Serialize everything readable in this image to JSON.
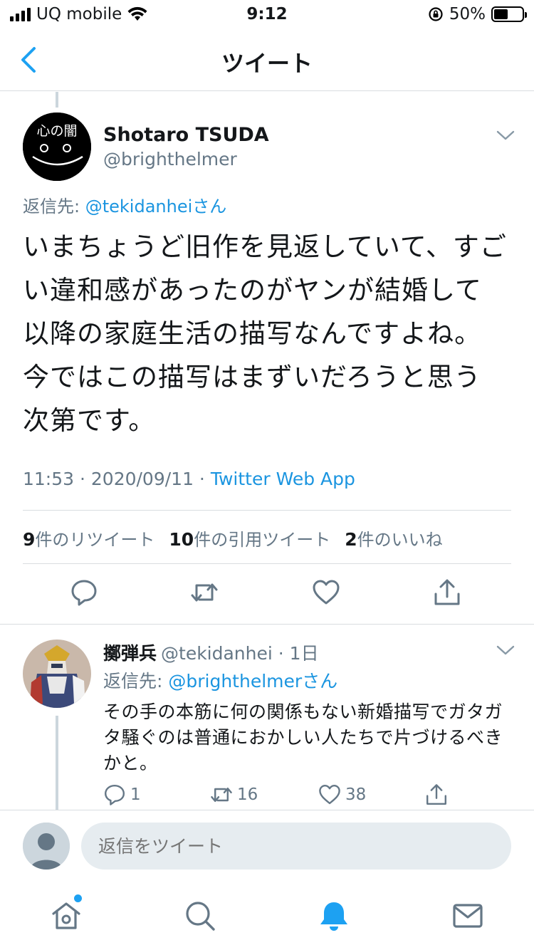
{
  "status_bar": {
    "carrier": "UQ mobile",
    "time": "9:12",
    "battery_percent": "50%",
    "battery_level": 0.5
  },
  "nav": {
    "title": "ツイート"
  },
  "tweet": {
    "display_name": "Shotaro TSUDA",
    "handle": "@brighthelmer",
    "avatar_text": "心の闇",
    "reply_prefix": "返信先: ",
    "reply_target": "@tekidanheiさん",
    "text": "いまちょうど旧作を見返していて、すごい違和感があったのがヤンが結婚して以降の家庭生活の描写なんですよね。今ではこの描写はまずいだろうと思う次第です。",
    "timestamp": "11:53 · 2020/09/11 · ",
    "source": "Twitter Web App",
    "retweet_count": "9",
    "retweet_label": "件のリツイート",
    "quote_count": "10",
    "quote_label": "件の引用ツイート",
    "like_count": "2",
    "like_label": "件のいいね"
  },
  "reply": {
    "display_name": "擲弾兵",
    "handle": "@tekidanhei · 1日",
    "reply_prefix": "返信先: ",
    "reply_target": "@brighthelmerさん",
    "text": "その手の本筋に何の関係もない新婚描写でガタガタ騒ぐのは普通におかしい人たちで片づけるべきかと。",
    "reply_count": "1",
    "retweet_count": "16",
    "like_count": "38"
  },
  "compose": {
    "placeholder": "返信をツイート"
  },
  "tab_bar": {
    "items": [
      "home-icon",
      "search-icon",
      "notifications-icon",
      "messages-icon"
    ]
  },
  "colors": {
    "accent": "#1da1f2",
    "link": "#1b95e0",
    "secondary_text": "#657786",
    "divider": "#d9dde0"
  }
}
